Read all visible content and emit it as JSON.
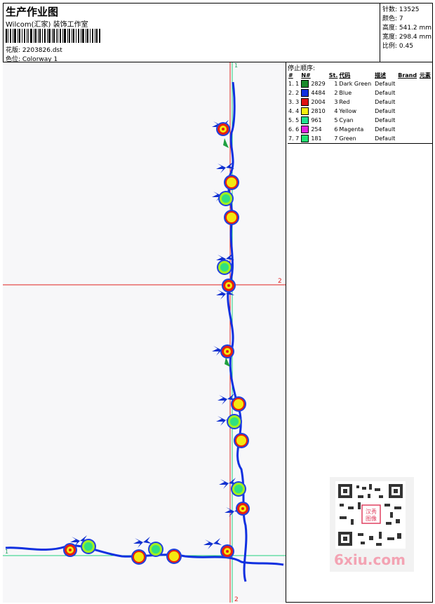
{
  "header": {
    "title": "生产作业图",
    "company": "Wilcom(汇家) 装饰工作室",
    "design_line": "花版:  2203826.dst",
    "colorway_line": "色位:  Colorway 1"
  },
  "stats": {
    "stitches": "针数:  13525",
    "colors": "颜色:  7",
    "height": "高度:  541.2 mm",
    "width": "宽度:  298.4 mm",
    "scale": "比例:  0.45"
  },
  "canvas": {
    "guide_top_label": "1",
    "guide_bottom_label": "2",
    "guide_right_label": "2",
    "guide_left_label": "1"
  },
  "stop_sequence": {
    "title": "停止顺序:",
    "headers": [
      "#",
      "N#",
      "St.",
      "代码",
      "描述",
      "Brand",
      "元素"
    ],
    "rows": [
      {
        "idx": "1. 1",
        "color": "#1a8a2a",
        "stitches": "2829",
        "code": "1",
        "desc": "Dark Green",
        "brand": "Default"
      },
      {
        "idx": "2. 2",
        "color": "#1030e0",
        "stitches": "4484",
        "code": "2",
        "desc": "Blue",
        "brand": "Default"
      },
      {
        "idx": "3. 3",
        "color": "#e01010",
        "stitches": "2004",
        "code": "3",
        "desc": "Red",
        "brand": "Default"
      },
      {
        "idx": "4. 4",
        "color": "#f5f010",
        "stitches": "2810",
        "code": "4",
        "desc": "Yellow",
        "brand": "Default"
      },
      {
        "idx": "5. 5",
        "color": "#20e090",
        "stitches": "961",
        "code": "5",
        "desc": "Cyan",
        "brand": "Default"
      },
      {
        "idx": "6. 6",
        "color": "#e020e0",
        "stitches": "254",
        "code": "6",
        "desc": "Magenta",
        "brand": "Default"
      },
      {
        "idx": "7. 7",
        "color": "#20e070",
        "stitches": "181",
        "code": "7",
        "desc": "Green",
        "brand": "Default"
      }
    ]
  },
  "watermark": {
    "text": "6xiu.com",
    "seal": "汉秀图像"
  }
}
